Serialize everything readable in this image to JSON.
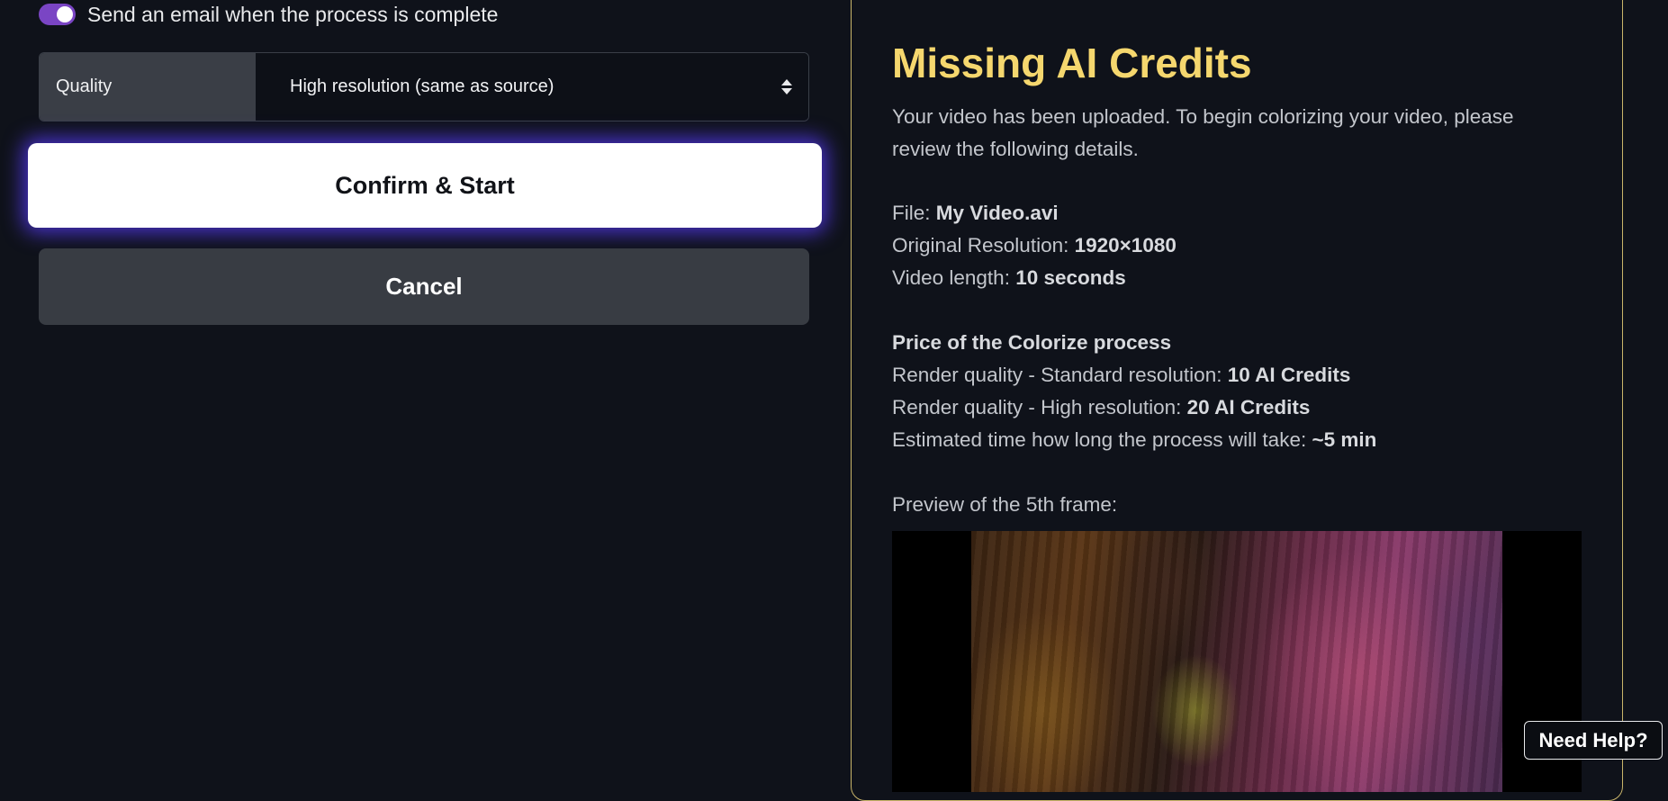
{
  "email_toggle": {
    "label": "Send an email when the process is complete",
    "checked": true,
    "color": "#7a45c4"
  },
  "quality": {
    "label": "Quality",
    "selected": "High resolution (same as source)"
  },
  "buttons": {
    "confirm": "Confirm & Start",
    "cancel": "Cancel",
    "help": "Need Help?"
  },
  "panel": {
    "title": "Missing AI Credits",
    "title_color": "#f5d76e",
    "intro": "Your video has been uploaded. To begin colorizing your video, please review the following details.",
    "details": [
      {
        "label": "File: ",
        "value": "My Video.avi"
      },
      {
        "label": "Original Resolution: ",
        "value": "1920×1080"
      },
      {
        "label": "Video length: ",
        "value": "10 seconds"
      }
    ],
    "pricing": {
      "heading": "Price of the Colorize process",
      "rows": [
        {
          "label": "Render quality - Standard resolution: ",
          "value": "10 AI Credits"
        },
        {
          "label": "Render quality - High resolution: ",
          "value": "20 AI Credits"
        },
        {
          "label": "Estimated time how long the process will take: ",
          "value": "~5 min"
        }
      ]
    },
    "preview_label": "Preview of the 5th frame:"
  }
}
